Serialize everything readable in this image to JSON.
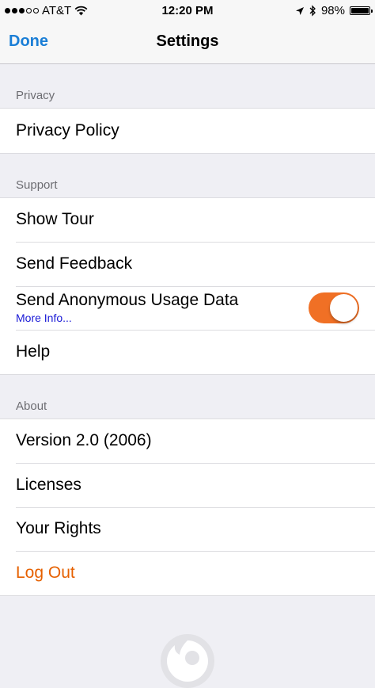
{
  "status_bar": {
    "carrier": "AT&T",
    "time": "12:20 PM",
    "battery": "98%",
    "battery_level": 0.98,
    "icons": [
      "signal-dots-icon",
      "wifi-icon",
      "location-arrow-icon",
      "bluetooth-icon",
      "battery-icon"
    ]
  },
  "navbar": {
    "done_label": "Done",
    "title": "Settings"
  },
  "sections": {
    "privacy": {
      "header": "Privacy",
      "items": [
        "Privacy Policy"
      ]
    },
    "support": {
      "header": "Support",
      "items": [
        "Show Tour",
        "Send Feedback",
        "Send Anonymous Usage Data",
        "Help"
      ],
      "usage_sub_link": "More Info...",
      "usage_toggle_on": true
    },
    "about": {
      "header": "About",
      "items": [
        "Version 2.0 (2006)",
        "Licenses",
        "Your Rights",
        "Log Out"
      ]
    }
  },
  "colors": {
    "accent_blue": "#1a7ed6",
    "link_blue": "#1a1ad6",
    "toggle_orange": "#f07025",
    "logout_orange": "#e66000",
    "background": "#efeff4"
  }
}
